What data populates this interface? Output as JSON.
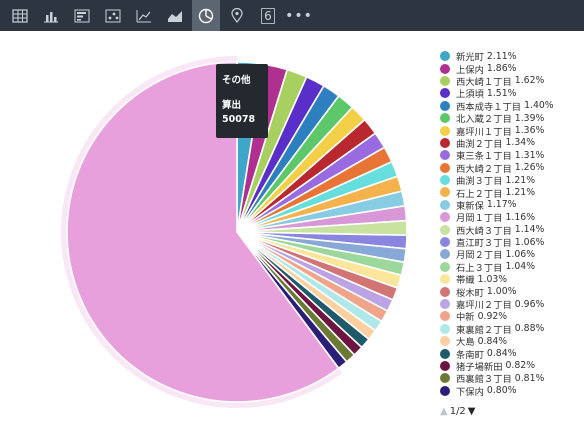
{
  "toolbar": {
    "icons": [
      "table-icon",
      "bar-chart-icon",
      "list-bar-icon",
      "scatter-icon",
      "line-chart-icon",
      "area-chart-icon",
      "pie-chart-icon",
      "map-pin-icon",
      "number-icon",
      "more-icon"
    ],
    "active": "pie-chart-icon",
    "number_label": "6",
    "more_label": "•••",
    "colors": {
      "background": "#2d3640",
      "active": "#5b6672",
      "icon": "#c9d0d8"
    }
  },
  "tooltip": {
    "name": "その他",
    "label": "算出",
    "value": "50078"
  },
  "pager": {
    "text": "1/2",
    "up": "▲",
    "down": "▼"
  },
  "chart_data": {
    "type": "pie",
    "slices": [
      {
        "name": "新光町",
        "value": 2.11,
        "color": "#3ea6c8"
      },
      {
        "name": "上保内",
        "value": 1.86,
        "color": "#b03090"
      },
      {
        "name": "西大崎１丁目",
        "value": 1.62,
        "color": "#a8d060"
      },
      {
        "name": "上須頃",
        "value": 1.51,
        "color": "#5a2ec8"
      },
      {
        "name": "西本成寺１丁目",
        "value": 1.4,
        "color": "#2e7fc0"
      },
      {
        "name": "北入蔵２丁目",
        "value": 1.39,
        "color": "#5cc86a"
      },
      {
        "name": "嘉坪川１丁目",
        "value": 1.36,
        "color": "#f4d048"
      },
      {
        "name": "曲渕２丁目",
        "value": 1.34,
        "color": "#b8282e"
      },
      {
        "name": "東三条１丁目",
        "value": 1.31,
        "color": "#9a6ae0"
      },
      {
        "name": "西大崎２丁目",
        "value": 1.26,
        "color": "#e87436"
      },
      {
        "name": "曲渕３丁目",
        "value": 1.21,
        "color": "#66dede"
      },
      {
        "name": "石上２丁目",
        "value": 1.21,
        "color": "#f4b24c"
      },
      {
        "name": "東新保",
        "value": 1.17,
        "color": "#88cce4"
      },
      {
        "name": "月岡１丁目",
        "value": 1.16,
        "color": "#d898d8"
      },
      {
        "name": "西大崎３丁目",
        "value": 1.14,
        "color": "#c8e2a0"
      },
      {
        "name": "直江町３丁目",
        "value": 1.06,
        "color": "#8a86e0"
      },
      {
        "name": "月岡２丁目",
        "value": 1.06,
        "color": "#88a8d8"
      },
      {
        "name": "石上３丁目",
        "value": 1.04,
        "color": "#9cd89c"
      },
      {
        "name": "帯織",
        "value": 1.03,
        "color": "#fce69c"
      },
      {
        "name": "桜木町",
        "value": 1.0,
        "color": "#d07474"
      },
      {
        "name": "嘉坪川２丁目",
        "value": 0.96,
        "color": "#bca4e4"
      },
      {
        "name": "中新",
        "value": 0.92,
        "color": "#f0a48a"
      },
      {
        "name": "東裏館２丁目",
        "value": 0.88,
        "color": "#aee8e8"
      },
      {
        "name": "大島",
        "value": 0.84,
        "color": "#fcd0a0"
      },
      {
        "name": "条南町",
        "value": 0.84,
        "color": "#1e5a6a"
      },
      {
        "name": "猪子場新田",
        "value": 0.82,
        "color": "#6e1440"
      },
      {
        "name": "西裏館３丁目",
        "value": 0.81,
        "color": "#6a7a34"
      },
      {
        "name": "下保内",
        "value": 0.8,
        "color": "#2a1e78"
      },
      {
        "name": "その他",
        "value": 50.08,
        "color": "#e8a0dc"
      }
    ],
    "legend_visible": [
      {
        "name": "新光町",
        "pct": "2.11%"
      },
      {
        "name": "上保内",
        "pct": "1.86%"
      },
      {
        "name": "西大崎１丁目",
        "pct": "1.62%"
      },
      {
        "name": "上須頃",
        "pct": "1.51%"
      },
      {
        "name": "西本成寺１丁目",
        "pct": "1.40%"
      },
      {
        "name": "北入蔵２丁目",
        "pct": "1.39%"
      },
      {
        "name": "嘉坪川１丁目",
        "pct": "1.36%"
      },
      {
        "name": "曲渕２丁目",
        "pct": "1.34%"
      },
      {
        "name": "東三条１丁目",
        "pct": "1.31%"
      },
      {
        "name": "西大崎２丁目",
        "pct": "1.26%"
      },
      {
        "name": "曲渕３丁目",
        "pct": "1.21%"
      },
      {
        "name": "石上２丁目",
        "pct": "1.21%"
      },
      {
        "name": "東新保",
        "pct": "1.17%"
      },
      {
        "name": "月岡１丁目",
        "pct": "1.16%"
      },
      {
        "name": "西大崎３丁目",
        "pct": "1.14%"
      },
      {
        "name": "直江町３丁目",
        "pct": "1.06%"
      },
      {
        "name": "月岡２丁目",
        "pct": "1.06%"
      },
      {
        "name": "石上３丁目",
        "pct": "1.04%"
      },
      {
        "name": "帯織",
        "pct": "1.03%"
      },
      {
        "name": "桜木町",
        "pct": "1.00%"
      },
      {
        "name": "嘉坪川２丁目",
        "pct": "0.96%"
      },
      {
        "name": "中新",
        "pct": "0.92%"
      },
      {
        "name": "東裏館２丁目",
        "pct": "0.88%"
      },
      {
        "name": "大島",
        "pct": "0.84%"
      },
      {
        "name": "条南町",
        "pct": "0.84%"
      },
      {
        "name": "猪子場新田",
        "pct": "0.82%"
      },
      {
        "name": "西裏館３丁目",
        "pct": "0.81%"
      },
      {
        "name": "下保内",
        "pct": "0.80%"
      }
    ],
    "highlighted": "その他",
    "legend_position": "right"
  }
}
